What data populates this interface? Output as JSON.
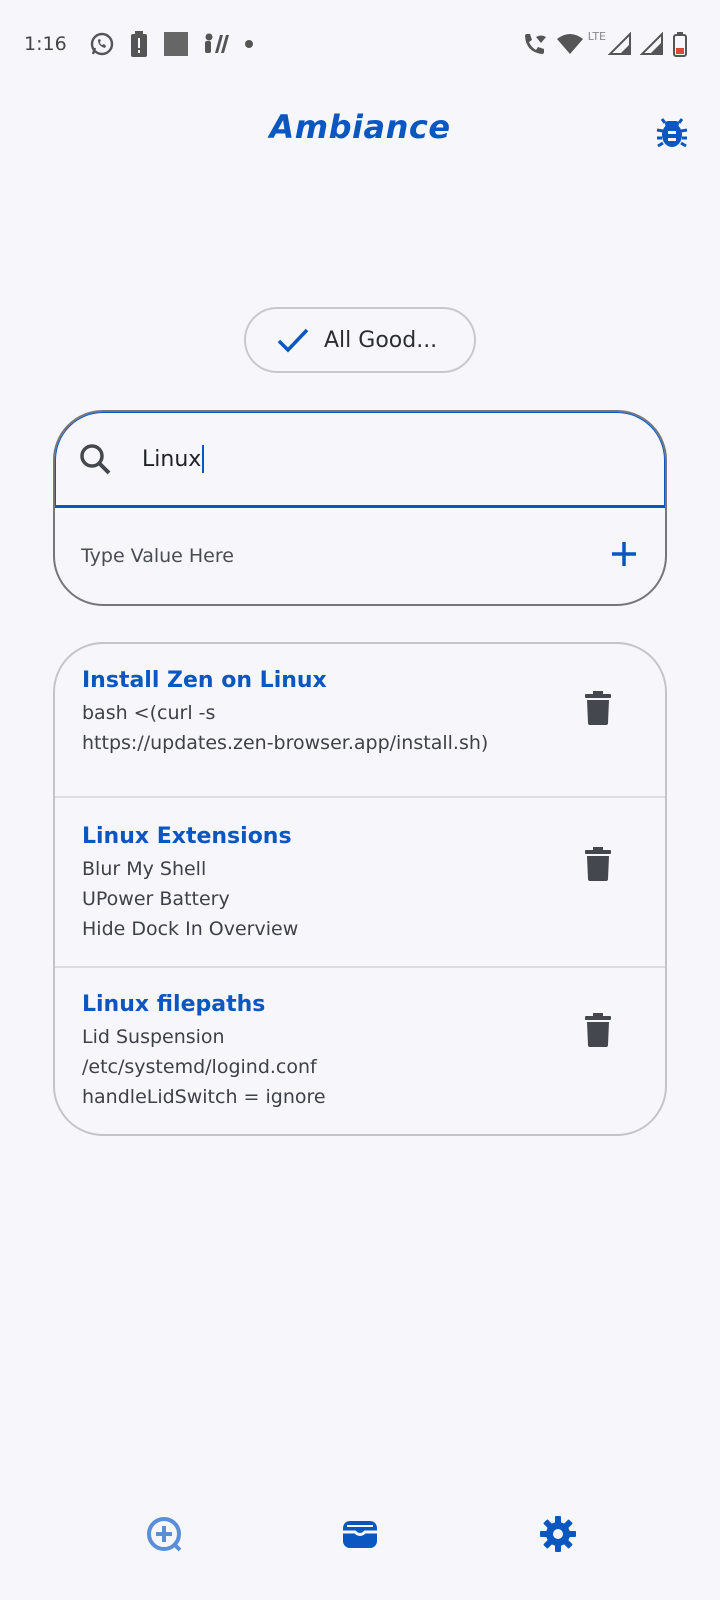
{
  "status_bar": {
    "time": "1:16",
    "network_label": "LTE"
  },
  "header": {
    "title": "Ambiance",
    "debug_icon": "bug-icon"
  },
  "status_pill": {
    "icon": "checkmark-icon",
    "label": "All Good..."
  },
  "search": {
    "icon": "search-icon",
    "value": "Linux"
  },
  "add_value": {
    "placeholder": "Type Value Here",
    "icon": "plus-icon"
  },
  "notes": [
    {
      "title": "Install Zen on Linux",
      "lines": [
        "bash <(curl -s",
        "https://updates.zen-browser.app/install.sh)"
      ]
    },
    {
      "title": "Linux Extensions",
      "lines": [
        "Blur My Shell",
        "UPower Battery",
        "Hide Dock In Overview"
      ]
    },
    {
      "title": "Linux filepaths",
      "lines": [
        "Lid Suspension",
        "/etc/systemd/logind.conf",
        "handleLidSwitch = ignore"
      ]
    }
  ],
  "bottom_nav": {
    "items": [
      {
        "icon": "add-circle-icon"
      },
      {
        "icon": "wallet-icon"
      },
      {
        "icon": "gear-icon"
      }
    ]
  },
  "colors": {
    "accent": "#0a57c2",
    "background": "#f6f6fb",
    "text": "#3b3d44",
    "delete_icon": "#45474e"
  }
}
